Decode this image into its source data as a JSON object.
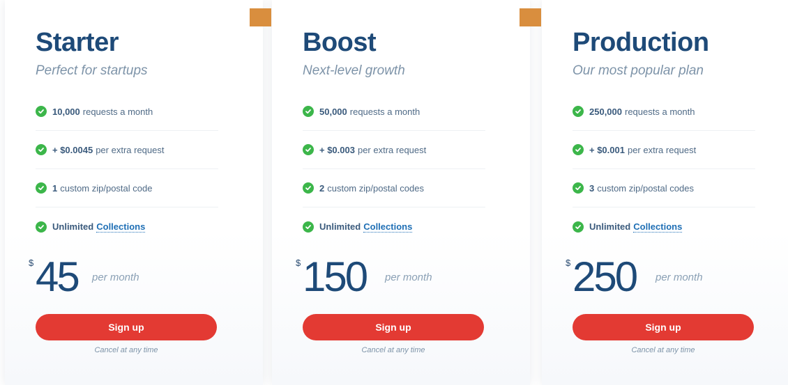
{
  "colors": {
    "title": "#1e4a78",
    "accent_ribbon": "#d98e3e",
    "check": "#3cb64a",
    "signup_button": "#e33a33",
    "link": "#1f6fb5"
  },
  "plans": [
    {
      "name": "Starter",
      "tagline": "Perfect for startups",
      "features": [
        {
          "strong": "10,000",
          "text": "requests a month"
        },
        {
          "strong": "+ $0.0045",
          "text": "per extra request"
        },
        {
          "strong": "1",
          "text": "custom zip/postal code"
        },
        {
          "strong": "Unlimited",
          "link": "Collections"
        }
      ],
      "currency": "$",
      "price": "45",
      "period": "per month",
      "cta": "Sign up",
      "note": "Cancel at any time"
    },
    {
      "name": "Boost",
      "tagline": "Next-level growth",
      "features": [
        {
          "strong": "50,000",
          "text": "requests a month"
        },
        {
          "strong": "+ $0.003",
          "text": "per extra request"
        },
        {
          "strong": "2",
          "text": "custom zip/postal codes"
        },
        {
          "strong": "Unlimited",
          "link": "Collections"
        }
      ],
      "currency": "$",
      "price": "150",
      "period": "per month",
      "cta": "Sign up",
      "note": "Cancel at any time"
    },
    {
      "name": "Production",
      "tagline": "Our most popular plan",
      "features": [
        {
          "strong": "250,000",
          "text": "requests a month"
        },
        {
          "strong": "+ $0.001",
          "text": "per extra request"
        },
        {
          "strong": "3",
          "text": "custom zip/postal codes"
        },
        {
          "strong": "Unlimited",
          "link": "Collections"
        }
      ],
      "currency": "$",
      "price": "250",
      "period": "per month",
      "cta": "Sign up",
      "note": "Cancel at any time"
    }
  ]
}
